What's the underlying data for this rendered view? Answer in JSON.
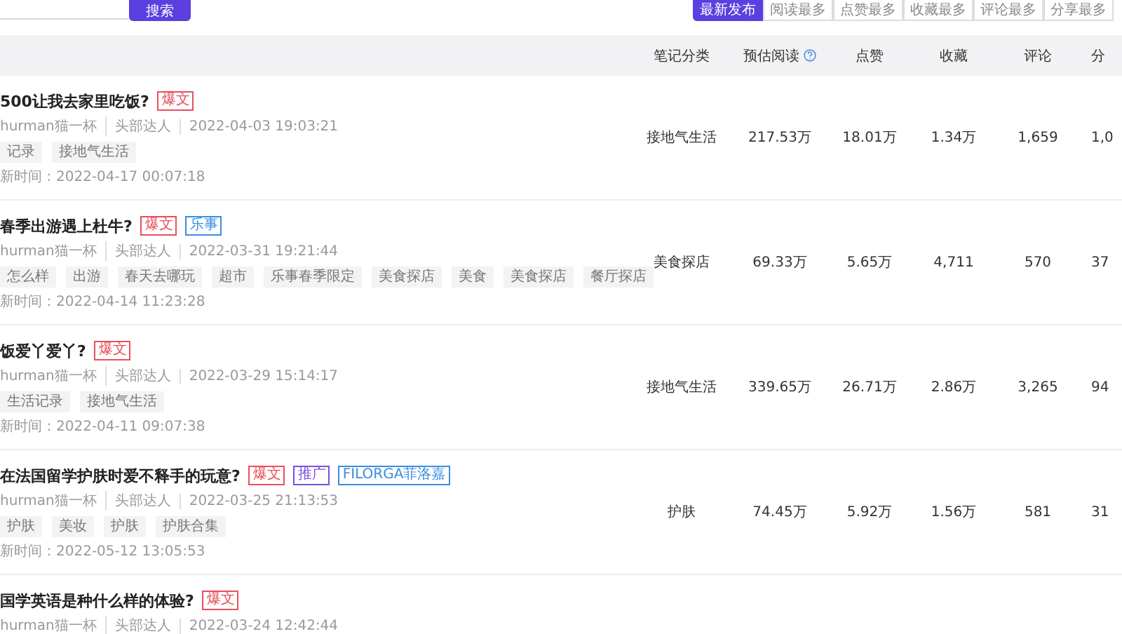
{
  "search": {
    "button": "搜索"
  },
  "sort_tabs": [
    {
      "label": "最新发布",
      "selected": true
    },
    {
      "label": "阅读最多",
      "selected": false
    },
    {
      "label": "点赞最多",
      "selected": false
    },
    {
      "label": "收藏最多",
      "selected": false
    },
    {
      "label": "评论最多",
      "selected": false
    },
    {
      "label": "分享最多",
      "selected": false
    }
  ],
  "table": {
    "columns": [
      "笔记分类",
      "预估阅读",
      "点赞",
      "收藏",
      "评论",
      "分"
    ],
    "rows": [
      {
        "title": "500让我去家里吃饭?",
        "badges": [
          {
            "label": "爆文",
            "color": "#e8505b"
          }
        ],
        "author": "hurman猫一杯",
        "level": "头部达人",
        "date": "2022-04-03 19:03:21",
        "tags": [
          "记录",
          "接地气生活"
        ],
        "updated": "新时间：2022-04-17 00:07:18",
        "cells": [
          "接地气生活",
          "217.53万",
          "18.01万",
          "1.34万",
          "1,659",
          "1,0"
        ]
      },
      {
        "title": "春季出游遇上杜牛?",
        "badges": [
          {
            "label": "爆文",
            "color": "#e8505b"
          },
          {
            "label": "乐事",
            "color": "#3b8de0"
          }
        ],
        "author": "hurman猫一杯",
        "level": "头部达人",
        "date": "2022-03-31 19:21:44",
        "tags": [
          "怎么样",
          "出游",
          "春天去哪玩",
          "超市",
          "乐事春季限定",
          "美食探店",
          "美食",
          "美食探店",
          "餐厅探店"
        ],
        "updated": "新时间：2022-04-14 11:23:28",
        "cells": [
          "美食探店",
          "69.33万",
          "5.65万",
          "4,711",
          "570",
          "37"
        ]
      },
      {
        "title": "饭爱丫爱丫?",
        "badges": [
          {
            "label": "爆文",
            "color": "#e8505b"
          }
        ],
        "author": "hurman猫一杯",
        "level": "头部达人",
        "date": "2022-03-29 15:14:17",
        "tags": [
          "生活记录",
          "接地气生活"
        ],
        "updated": "新时间：2022-04-11 09:07:38",
        "cells": [
          "接地气生活",
          "339.65万",
          "26.71万",
          "2.86万",
          "3,265",
          "94"
        ]
      },
      {
        "title": "在法国留学护肤时爱不释手的玩意?",
        "badges": [
          {
            "label": "爆文",
            "color": "#e8505b"
          },
          {
            "label": "推广",
            "color": "#7a4fe0"
          },
          {
            "label": "FILORGA菲洛嘉",
            "color": "#3b8de0"
          }
        ],
        "author": "hurman猫一杯",
        "level": "头部达人",
        "date": "2022-03-25 21:13:53",
        "tags": [
          "护肤",
          "美妆",
          "护肤",
          "护肤合集"
        ],
        "updated": "新时间：2022-05-12 13:05:53",
        "cells": [
          "护肤",
          "74.45万",
          "5.92万",
          "1.56万",
          "581",
          "31"
        ]
      },
      {
        "title": "国学英语是种什么样的体验?",
        "badges": [
          {
            "label": "爆文",
            "color": "#e8505b"
          }
        ],
        "author": "hurman猫一杯",
        "level": "头部达人",
        "date": "2022-03-24 12:42:44"
      }
    ]
  }
}
